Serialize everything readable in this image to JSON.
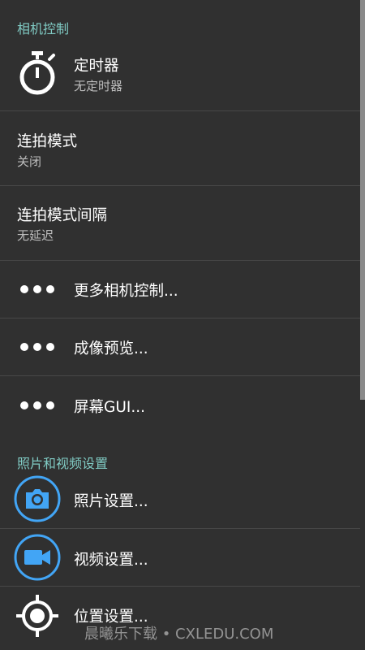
{
  "sections": {
    "camera_controls": "相机控制",
    "photo_video_settings": "照片和视频设置"
  },
  "items": {
    "timer": {
      "title": "定时器",
      "subtitle": "无定时器",
      "icon": "timer-icon"
    },
    "burst_mode": {
      "title": "连拍模式",
      "subtitle": "关闭"
    },
    "burst_interval": {
      "title": "连拍模式间隔",
      "subtitle": "无延迟"
    },
    "more_camera_controls": {
      "title": "更多相机控制...",
      "icon": "more-dots-icon"
    },
    "image_preview": {
      "title": "成像预览...",
      "icon": "more-dots-icon"
    },
    "screen_gui": {
      "title": "屏幕GUI...",
      "icon": "more-dots-icon"
    },
    "photo_settings": {
      "title": "照片设置...",
      "icon": "camera-icon"
    },
    "video_settings": {
      "title": "视频设置...",
      "icon": "video-camera-icon"
    },
    "location_settings": {
      "title": "位置设置...",
      "icon": "location-crosshair-icon"
    }
  },
  "watermark": "晨曦乐下载 • CXLEDU.COM",
  "colors": {
    "background": "#303030",
    "section_header": "#80cbc4",
    "accent_blue": "#42a5f5",
    "divider": "#474747"
  }
}
